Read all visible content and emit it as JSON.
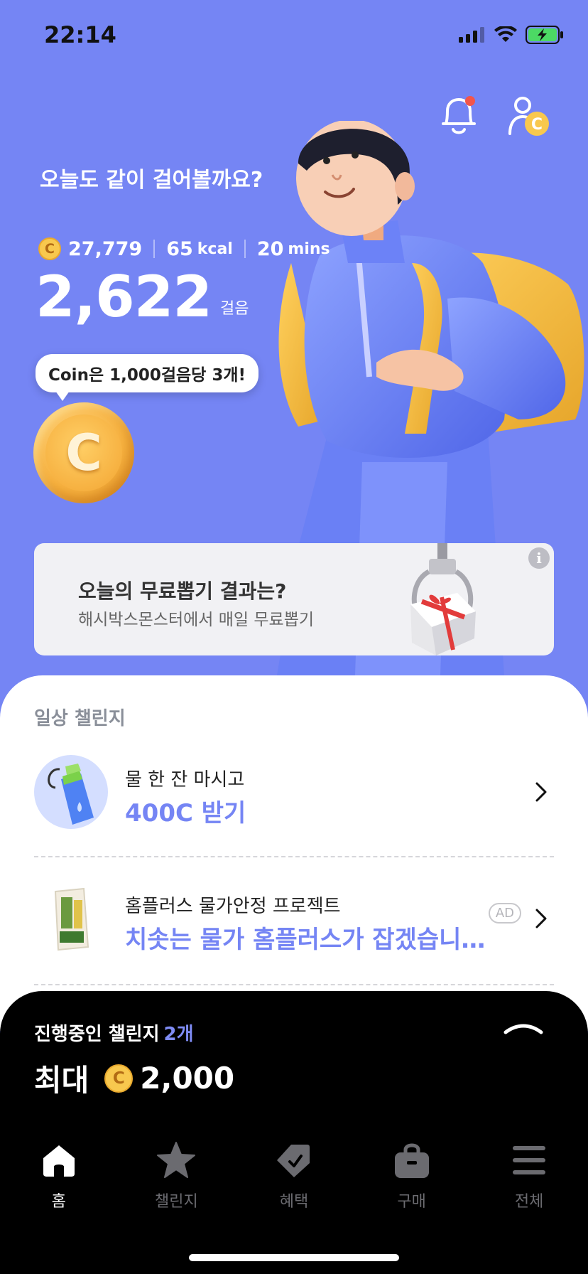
{
  "status_bar": {
    "time": "22:14"
  },
  "header": {
    "icons": [
      "notification-bell-icon",
      "profile-coin-icon"
    ],
    "notification_dot_color": "#f2554b"
  },
  "hero": {
    "greeting": "오늘도 같이 걸어볼까요?",
    "coins": "27,779",
    "calories": "65",
    "calories_unit": "kcal",
    "minutes": "20",
    "minutes_unit": "mins",
    "steps": "2,622",
    "steps_unit": "걸음",
    "tooltip": "Coin은 1,000걸음당 3개!",
    "coin_symbol": "C"
  },
  "banner": {
    "title": "오늘의 무료뽑기 결과는?",
    "subtitle": "해시박스몬스터에서 매일 무료뽑기",
    "info_symbol": "i"
  },
  "daily": {
    "section_title": "일상 챌린지",
    "items": [
      {
        "line1": "물 한 잔 마시고",
        "line2": "400C 받기",
        "icon": "water-bottle-icon"
      },
      {
        "line1": "홈플러스 물가안정 프로젝트",
        "line2": "치솟는 물가 홈플러스가 잡겠습니…",
        "icon": "rice-bag-icon",
        "badge": "AD"
      }
    ]
  },
  "ongoing": {
    "label": "진행중인 챌린지",
    "count": "2개",
    "max_label": "최대",
    "max_value": "2,000"
  },
  "tabs": [
    {
      "label": "홈",
      "icon": "home-icon",
      "active": true
    },
    {
      "label": "챌린지",
      "icon": "star-icon",
      "active": false
    },
    {
      "label": "혜택",
      "icon": "tag-icon",
      "active": false
    },
    {
      "label": "구매",
      "icon": "shopping-bag-icon",
      "active": false
    },
    {
      "label": "전체",
      "icon": "menu-icon",
      "active": false
    }
  ],
  "colors": {
    "background": "#7585f4",
    "accent": "#7585f4",
    "coin": "#f8c84e",
    "dark_panel": "#000000"
  }
}
